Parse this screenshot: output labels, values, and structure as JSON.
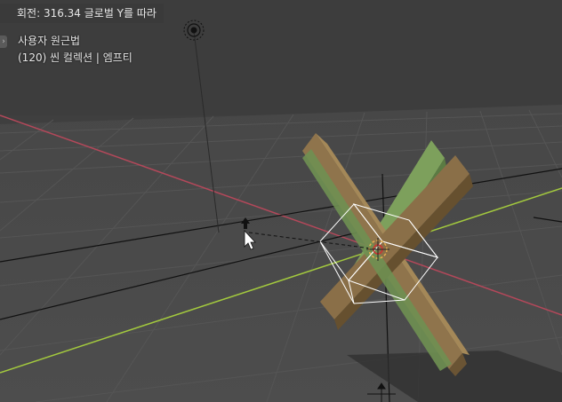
{
  "status": {
    "operation": "회전: 316.34 글로벌 Y를 따라"
  },
  "overlay": {
    "mode": "사용자 원근법",
    "info": "(120) 씬 컬렉션 | 엠프티"
  },
  "colors": {
    "background": "#3f3f3f",
    "x_axis": "#b3485a",
    "y_axis": "#a3c93e",
    "object_tan": "#8a6f48",
    "object_green": "#6f9052",
    "selection_white": "#ffffff"
  },
  "icons": {
    "light": "light-source-icon",
    "cursor": "mouse-pointer-icon",
    "origin": "3d-cursor-icon",
    "side_toggle": "chevron-right-icon"
  }
}
